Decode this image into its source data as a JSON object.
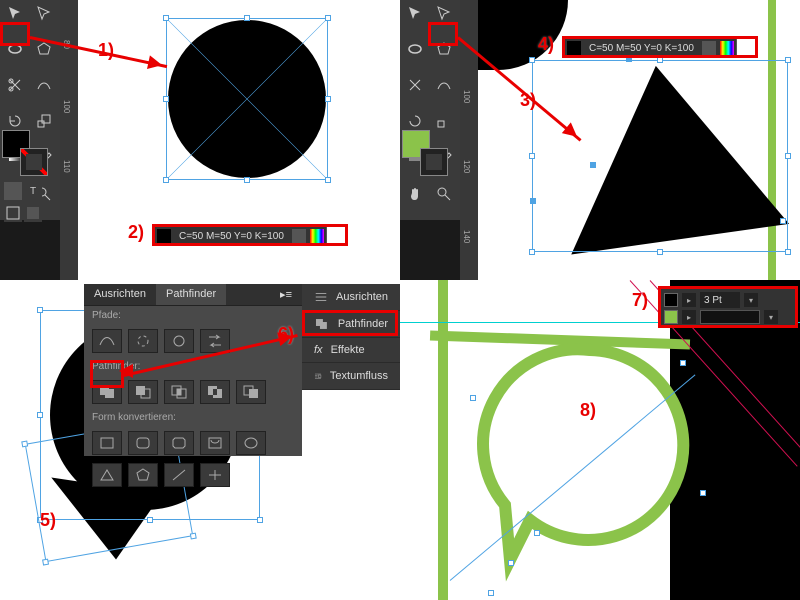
{
  "swatches": {
    "label1": "C=50 M=50 Y=0 K=100",
    "label2": "C=50 M=50 Y=0 K=100"
  },
  "steps": {
    "s1": "1)",
    "s2": "2)",
    "s3": "3)",
    "s4": "4)",
    "s5": "5)",
    "s6": "6)",
    "s7": "7)",
    "s8": "8)"
  },
  "panel": {
    "tab_ausrichten": "Ausrichten",
    "tab_pathfinder": "Pathfinder",
    "section_pfade": "Pfade:",
    "section_pathfinder": "Pathfinder:",
    "section_form": "Form konvertieren:"
  },
  "menu": {
    "ausrichten": "Ausrichten",
    "pathfinder": "Pathfinder",
    "effekte": "Effekte",
    "textumfluss": "Textumfluss"
  },
  "stroke": {
    "weight": "3 Pt"
  },
  "ruler": {
    "t80": "80",
    "t100": "100",
    "t110": "110",
    "t120": "120",
    "t140": "140"
  },
  "colors": {
    "black": "#000000",
    "green": "#8bc34a",
    "highlight": "#e80000",
    "selection": "#4fa3e3"
  }
}
